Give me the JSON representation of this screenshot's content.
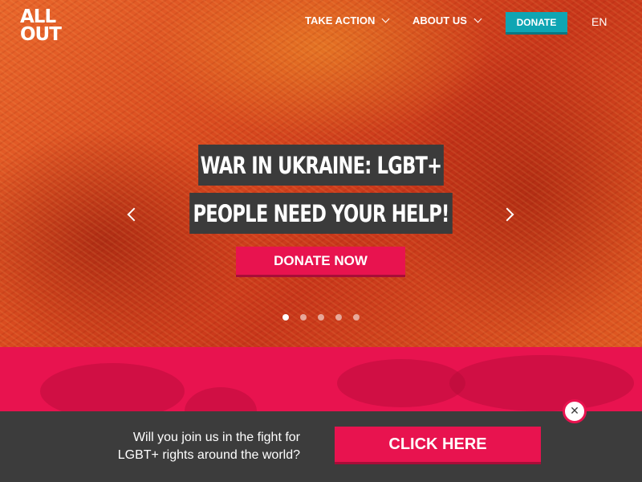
{
  "header": {
    "logo_line1": "ALL",
    "logo_line2": "OUT",
    "nav": [
      {
        "label": "TAKE ACTION"
      },
      {
        "label": "ABOUT US"
      }
    ],
    "donate_label": "DONATE",
    "language": "EN"
  },
  "hero": {
    "headline_line1": "WAR IN UKRAINE: LGBT+",
    "headline_line2": "PEOPLE NEED YOUR HELP!",
    "cta_label": "DONATE NOW",
    "slide_count": 5,
    "active_slide": 1
  },
  "popup": {
    "text_line1": "Will you join us in the fight for",
    "text_line2": "LGBT+ rights around the world?",
    "button_label": "CLICK HERE",
    "close_icon": "close-icon"
  },
  "colors": {
    "brand_pink": "#e8134f",
    "donate_teal": "#0fa5b3",
    "dark_bar": "#3c3c3c"
  }
}
